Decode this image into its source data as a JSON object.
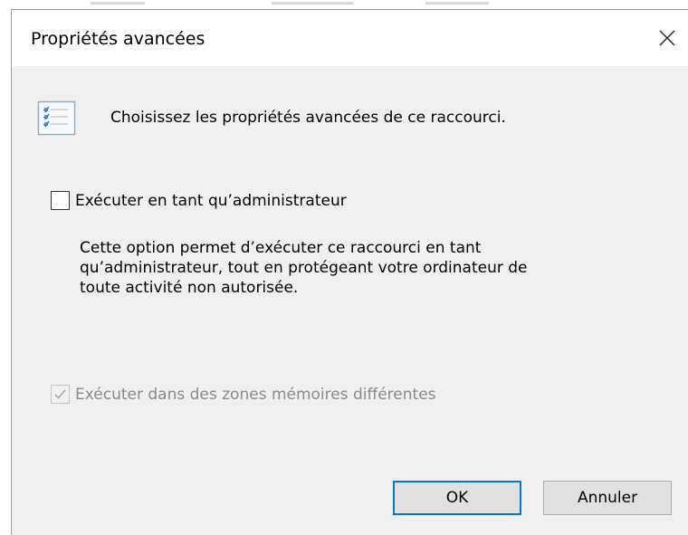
{
  "window": {
    "title": "Propriétés avancées",
    "close_icon": "close-icon"
  },
  "header": {
    "icon": "checklist-icon",
    "text": "Choisissez les propriétés avancées de ce raccourci."
  },
  "options": {
    "run_as_admin": {
      "label": "Exécuter en tant qu’administrateur",
      "checked": false,
      "enabled": true,
      "description": [
        "Cette option permet d’exécuter ce raccourci en tant",
        "qu’administrateur, tout en protégeant votre ordinateur de",
        "toute activité non autorisée."
      ]
    },
    "separate_memory": {
      "label": "Exécuter dans des zones mémoires différentes",
      "checked": true,
      "enabled": false
    }
  },
  "buttons": {
    "ok": "OK",
    "cancel": "Annuler"
  },
  "colors": {
    "dialog_bg": "#f0f0f0",
    "titlebar_bg": "#ffffff",
    "default_button_border": "#0078d7",
    "disabled_text": "#8a8a8a"
  }
}
